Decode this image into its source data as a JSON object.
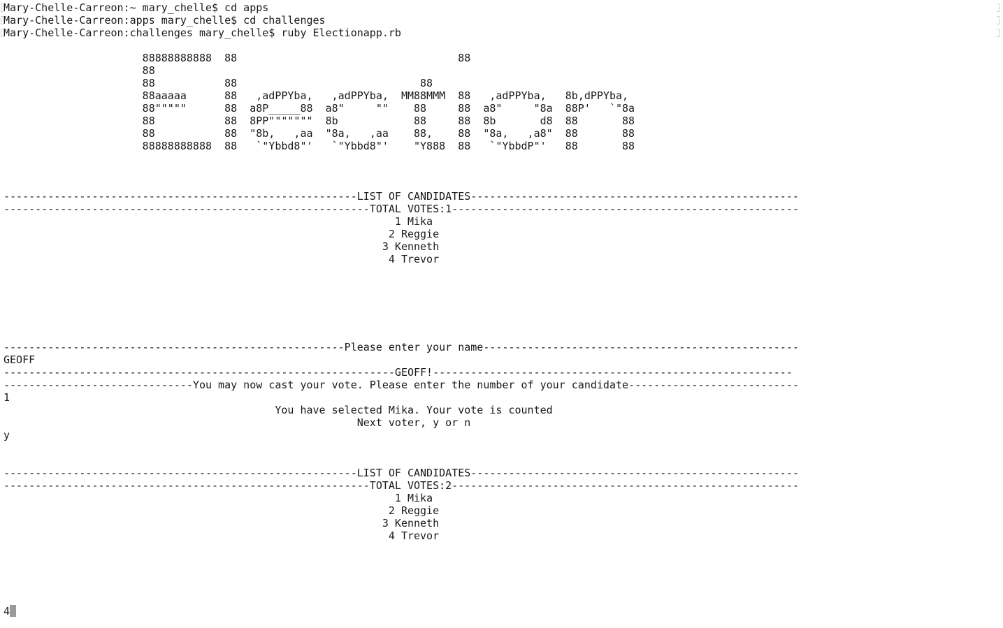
{
  "terminal": {
    "lines": [
      "Mary-Chelle-Carreon:~ mary_chelle$ cd apps",
      "Mary-Chelle-Carreon:apps mary_chelle$ cd challenges",
      "Mary-Chelle-Carreon:challenges mary_chelle$ ruby Electionapp.rb",
      "",
      "                      88888888888  88                                   88",
      "                      88",
      "                      88           88                             88",
      "                      88aaaaa      88   ,adPPYba,   ,adPPYba,  MM88MMM  88   ,adPPYba,   8b,dPPYba,",
      "                      88\"\"\"\"\"      88  a8P_____88  a8\"     \"\"    88     88  a8\"     \"8a  88P'   `\"8a",
      "                      88           88  8PP\"\"\"\"\"\"\"  8b            88     88  8b       d8  88       88",
      "                      88           88  \"8b,   ,aa  \"8a,   ,aa    88,    88  \"8a,   ,a8\"  88       88",
      "                      88888888888  88   `\"Ybbd8\"'   `\"Ybbd8\"'    \"Y888  88   `\"YbbdP\"'   88       88",
      "",
      "",
      "",
      "--------------------------------------------------------LIST OF CANDIDATES----------------------------------------------------",
      "----------------------------------------------------------TOTAL VOTES:1-------------------------------------------------------",
      "                                                              1 Mika",
      "                                                             2 Reggie",
      "                                                            3 Kenneth",
      "                                                             4 Trevor",
      "",
      "",
      "",
      "",
      "",
      "",
      "------------------------------------------------------Please enter your name--------------------------------------------------",
      "GEOFF",
      "--------------------------------------------------------------GEOFF!---------------------------------------------------------",
      "------------------------------You may now cast your vote. Please enter the number of your candidate---------------------------",
      "1",
      "                                           You have selected Mika. Your vote is counted",
      "                                                        Next voter, y or n",
      "y",
      "",
      "",
      "--------------------------------------------------------LIST OF CANDIDATES----------------------------------------------------",
      "----------------------------------------------------------TOTAL VOTES:2-------------------------------------------------------",
      "                                                              1 Mika",
      "                                                             2 Reggie",
      "                                                            3 Kenneth",
      "                                                             4 Trevor",
      "",
      "",
      "",
      "",
      "",
      "4"
    ]
  }
}
